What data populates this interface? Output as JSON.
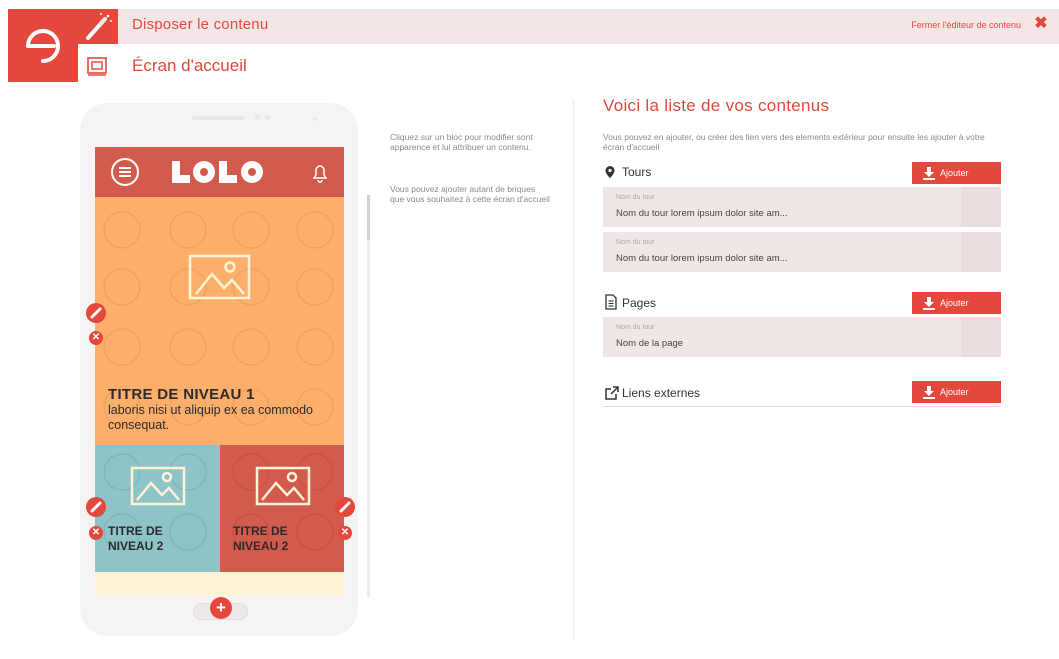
{
  "header": {
    "section_title": "Disposer le contenu",
    "page_title": "Écran d'accueil",
    "close_link": "Fermer l'éditeur de contenu",
    "close_icon": "✖"
  },
  "phone": {
    "app_logo": "LOLO",
    "hero": {
      "title": "TITRE DE NIVEAU 1",
      "text": "laboris nisi ut aliquip ex ea commodo consequat."
    },
    "tiles": [
      {
        "title": "TITRE DE NIVEAU 2"
      },
      {
        "title": "TITRE DE NIVEAU 2"
      }
    ],
    "add_symbol": "+"
  },
  "help": {
    "line1": "Cliquez sur un bloc pour modifier sont apparence et lui attribuer un contenu.",
    "line2": "Vous pouvez ajouter autant de briques que vous souhaitez à cette écran d'accueil"
  },
  "panel": {
    "title": "Voici la liste de vos contenus",
    "description": "Vous pouvez en ajouter, ou créer des lien vers des elements extérieur pour ensuite les ajouter à votre écran d'accueil",
    "sections": [
      {
        "label": "Tours",
        "add_label": "Ajouter",
        "rows": [
          {
            "label": "Nom du  tour",
            "value": "Nom du  tour lorem ipsum dolor site am..."
          },
          {
            "label": "Nom du  tour",
            "value": "Nom du  tour lorem ipsum dolor site am..."
          }
        ]
      },
      {
        "label": "Pages",
        "add_label": "Ajouter",
        "rows": [
          {
            "label": "Nom du  tour",
            "value": "Nom de la page"
          }
        ]
      },
      {
        "label": "Liens externes",
        "add_label": "Ajouter",
        "rows": []
      }
    ]
  },
  "colors": {
    "accent": "#e4483d",
    "header_bg": "#f4e6e6",
    "hero_orange": "#fcae6b",
    "tile_blue": "#8ec3c8",
    "tile_red": "#d35b4e"
  }
}
